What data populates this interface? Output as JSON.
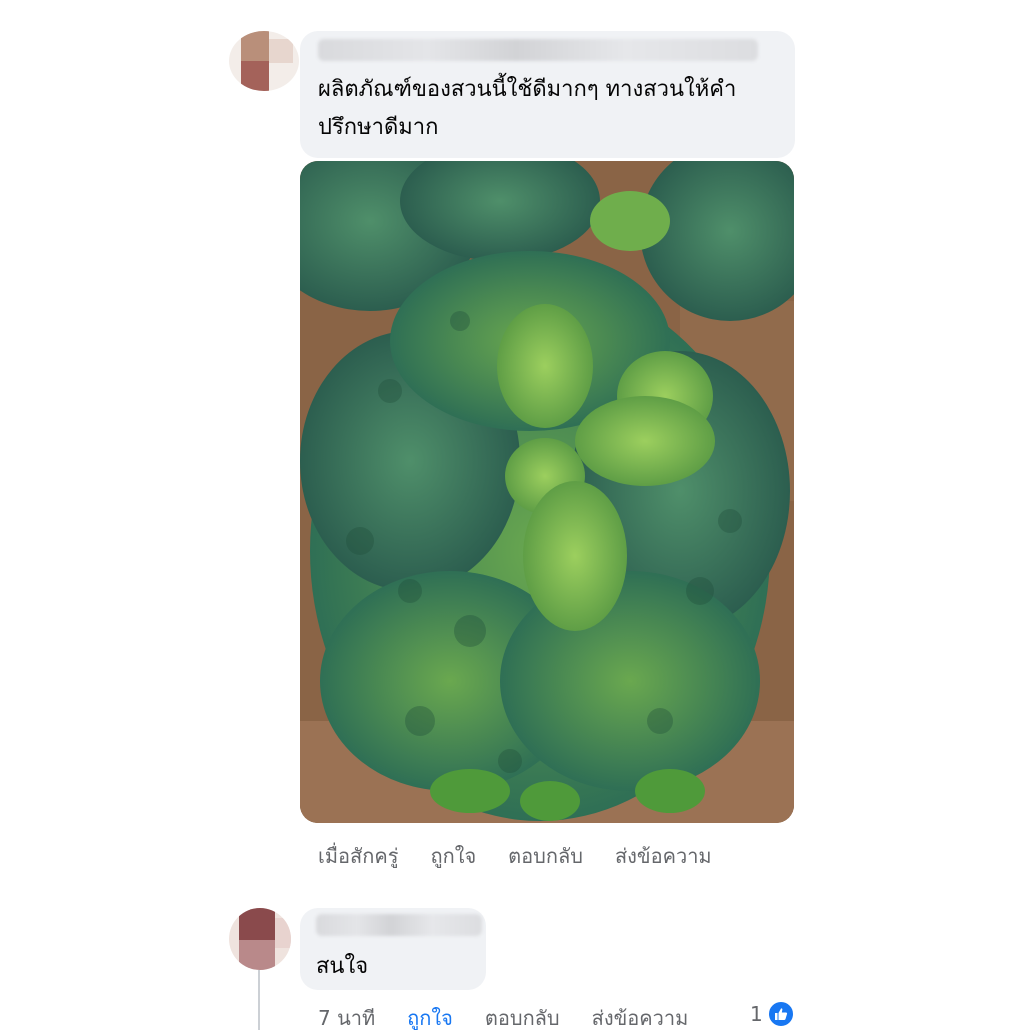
{
  "comments": [
    {
      "text": "ผลิตภัณฑ์ของสวนนี้ใช้ดีมากๆ ทางสวนให้คำปรึกษาดีมาก",
      "line1": "ผลิตภัณฑ์ของสวนนี้ใช้ดีมากๆ ทางสวนให้คำ",
      "line2": "ปรึกษาดีมาก",
      "attachment_icon": "kale-photo",
      "actions": {
        "time": "เมื่อสักครู่",
        "like": "ถูกใจ",
        "reply": "ตอบกลับ",
        "message": "ส่งข้อความ"
      }
    },
    {
      "text": "สนใจ",
      "actions": {
        "time": "7 นาที",
        "like": "ถูกใจ",
        "reply": "ตอบกลับ",
        "message": "ส่งข้อความ"
      },
      "like_count": "1"
    }
  ],
  "colors": {
    "bubble": "#f0f2f5",
    "action_text": "#65676b",
    "liked": "#1877f2"
  }
}
